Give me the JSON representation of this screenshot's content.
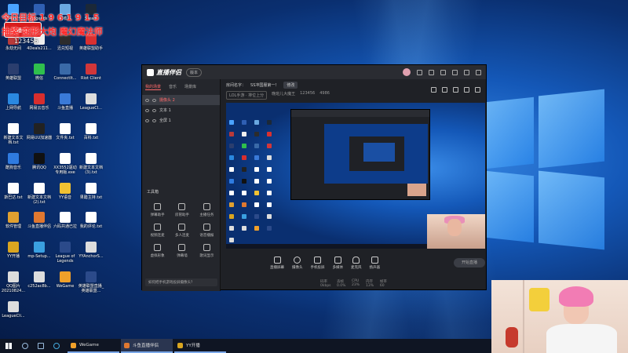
{
  "overlay": {
    "line1": "今日目标 1 9 6 1 9 1 5",
    "line2": "抽奖 变形大炮 魔幻魔法师",
    "badge": "直播号",
    "number": "123456"
  },
  "desktop_icons": [
    {
      "label": "2345安全",
      "color": "#4aa3ff"
    },
    {
      "label": "Legends",
      "color": "#2f5fb3"
    },
    {
      "label": "回收站",
      "color": "#6aa8e0"
    },
    {
      "label": "Steam",
      "color": "#1b2838"
    },
    {
      "label": "永劫无间",
      "color": "#b83a3a"
    },
    {
      "label": "4Deals211...",
      "color": "#eeeeee"
    },
    {
      "label": "迅兑短视",
      "color": "#2c2c2c"
    },
    {
      "label": "英雄联盟助手",
      "color": "#d93030"
    },
    {
      "label": "英雄联盟",
      "color": "#2b3e6e"
    },
    {
      "label": "微信",
      "color": "#2fbf4d"
    },
    {
      "label": "ConnectIt...",
      "color": "#3a6aa8"
    },
    {
      "label": "Riot Client",
      "color": "#d1363a"
    },
    {
      "label": "上网导航",
      "color": "#2a88e0"
    },
    {
      "label": "网易云音乐",
      "color": "#d82e2e"
    },
    {
      "label": "斗鱼直播",
      "color": "#3a7ad8"
    },
    {
      "label": "LeagueCl...",
      "color": "#dddddd"
    },
    {
      "label": "新建文本文档.txt",
      "color": "#ffffff"
    },
    {
      "label": "网易UU加速器",
      "color": "#222222"
    },
    {
      "label": "文件夹.txt",
      "color": "#ffffff"
    },
    {
      "label": "百科.txt",
      "color": "#ffffff"
    },
    {
      "label": "酷狗音乐",
      "color": "#2f7be0"
    },
    {
      "label": "腾讯QQ",
      "color": "#111111"
    },
    {
      "label": "XX3552驱动专用版.exe",
      "color": "#ffffff"
    },
    {
      "label": "新建文本文档(3).txt",
      "color": "#ffffff"
    },
    {
      "label": "斯巴达.txt",
      "color": "#ffffff"
    },
    {
      "label": "新建文本文档(2).txt",
      "color": "#ffffff"
    },
    {
      "label": "YY语音",
      "color": "#f1c232"
    },
    {
      "label": "果醋主持.txt",
      "color": "#ffffff"
    },
    {
      "label": "软件管理",
      "color": "#e0a030"
    },
    {
      "label": "斗鱼直播伴侣",
      "color": "#e07830"
    },
    {
      "label": "六码共通已拉",
      "color": "#ffffff"
    },
    {
      "label": "我的评论.txt",
      "color": "#ffffff"
    },
    {
      "label": "YY开播",
      "color": "#d9a520"
    },
    {
      "label": "mp-Setup...",
      "color": "#3aa0e0"
    },
    {
      "label": "League of Legends",
      "color": "#2b4a8a"
    },
    {
      "label": "YYAnchorS...",
      "color": "#dddddd"
    },
    {
      "label": "QQ图片20210824...",
      "color": "#dddddd"
    },
    {
      "label": "c252ac8b...",
      "color": "#dddddd"
    },
    {
      "label": "WeGame",
      "color": "#f0a02a"
    },
    {
      "label": "英雄联盟直播_英雄联盟...",
      "color": "#2b4a8a"
    },
    {
      "label": "LeagueCli...",
      "color": "#dddddd"
    }
  ],
  "app": {
    "name": "直播伴侣",
    "version": "版本",
    "left_tabs": [
      "我的场景",
      "音乐",
      "场景库"
    ],
    "scenes": [
      {
        "name": "摄像头 2"
      },
      {
        "name": "文本 1"
      },
      {
        "name": "全屏 1"
      }
    ],
    "tools_title": "工具箱",
    "tools": [
      "弹幕助手",
      "房管助手",
      "主播任务",
      "视频连麦",
      "多人连麦",
      "语音播报",
      "虚拟形象",
      "弹幕墙",
      "歌词显示"
    ],
    "bottom_hint": "如何把手机游戏投屏摄像头？",
    "room": {
      "title_label": "房间名字：",
      "title_value": "SS冲国服第一！",
      "edit_btn": "修改",
      "category": "LOL手游 · 排位上分",
      "owner": "晚班儿大魔王",
      "room_id": "123456",
      "heat": "4986"
    },
    "controls": [
      "直播屏幕",
      "摄像头",
      "手机投屏",
      "多媒体",
      "麦克风",
      "扬声器"
    ],
    "go_live": "开始直播",
    "status": [
      "码率 0kbps",
      "丢帧 0.0%",
      "CPU 23%",
      "内存 13%",
      "帧率 60"
    ]
  },
  "taskbar": {
    "apps": [
      {
        "label": "WeGame",
        "color": "#f0a02a",
        "active": false
      },
      {
        "label": "斗鱼直播伴侣",
        "color": "#e07830",
        "active": true
      },
      {
        "label": "YY开播",
        "color": "#d9a520",
        "active": false
      }
    ]
  }
}
